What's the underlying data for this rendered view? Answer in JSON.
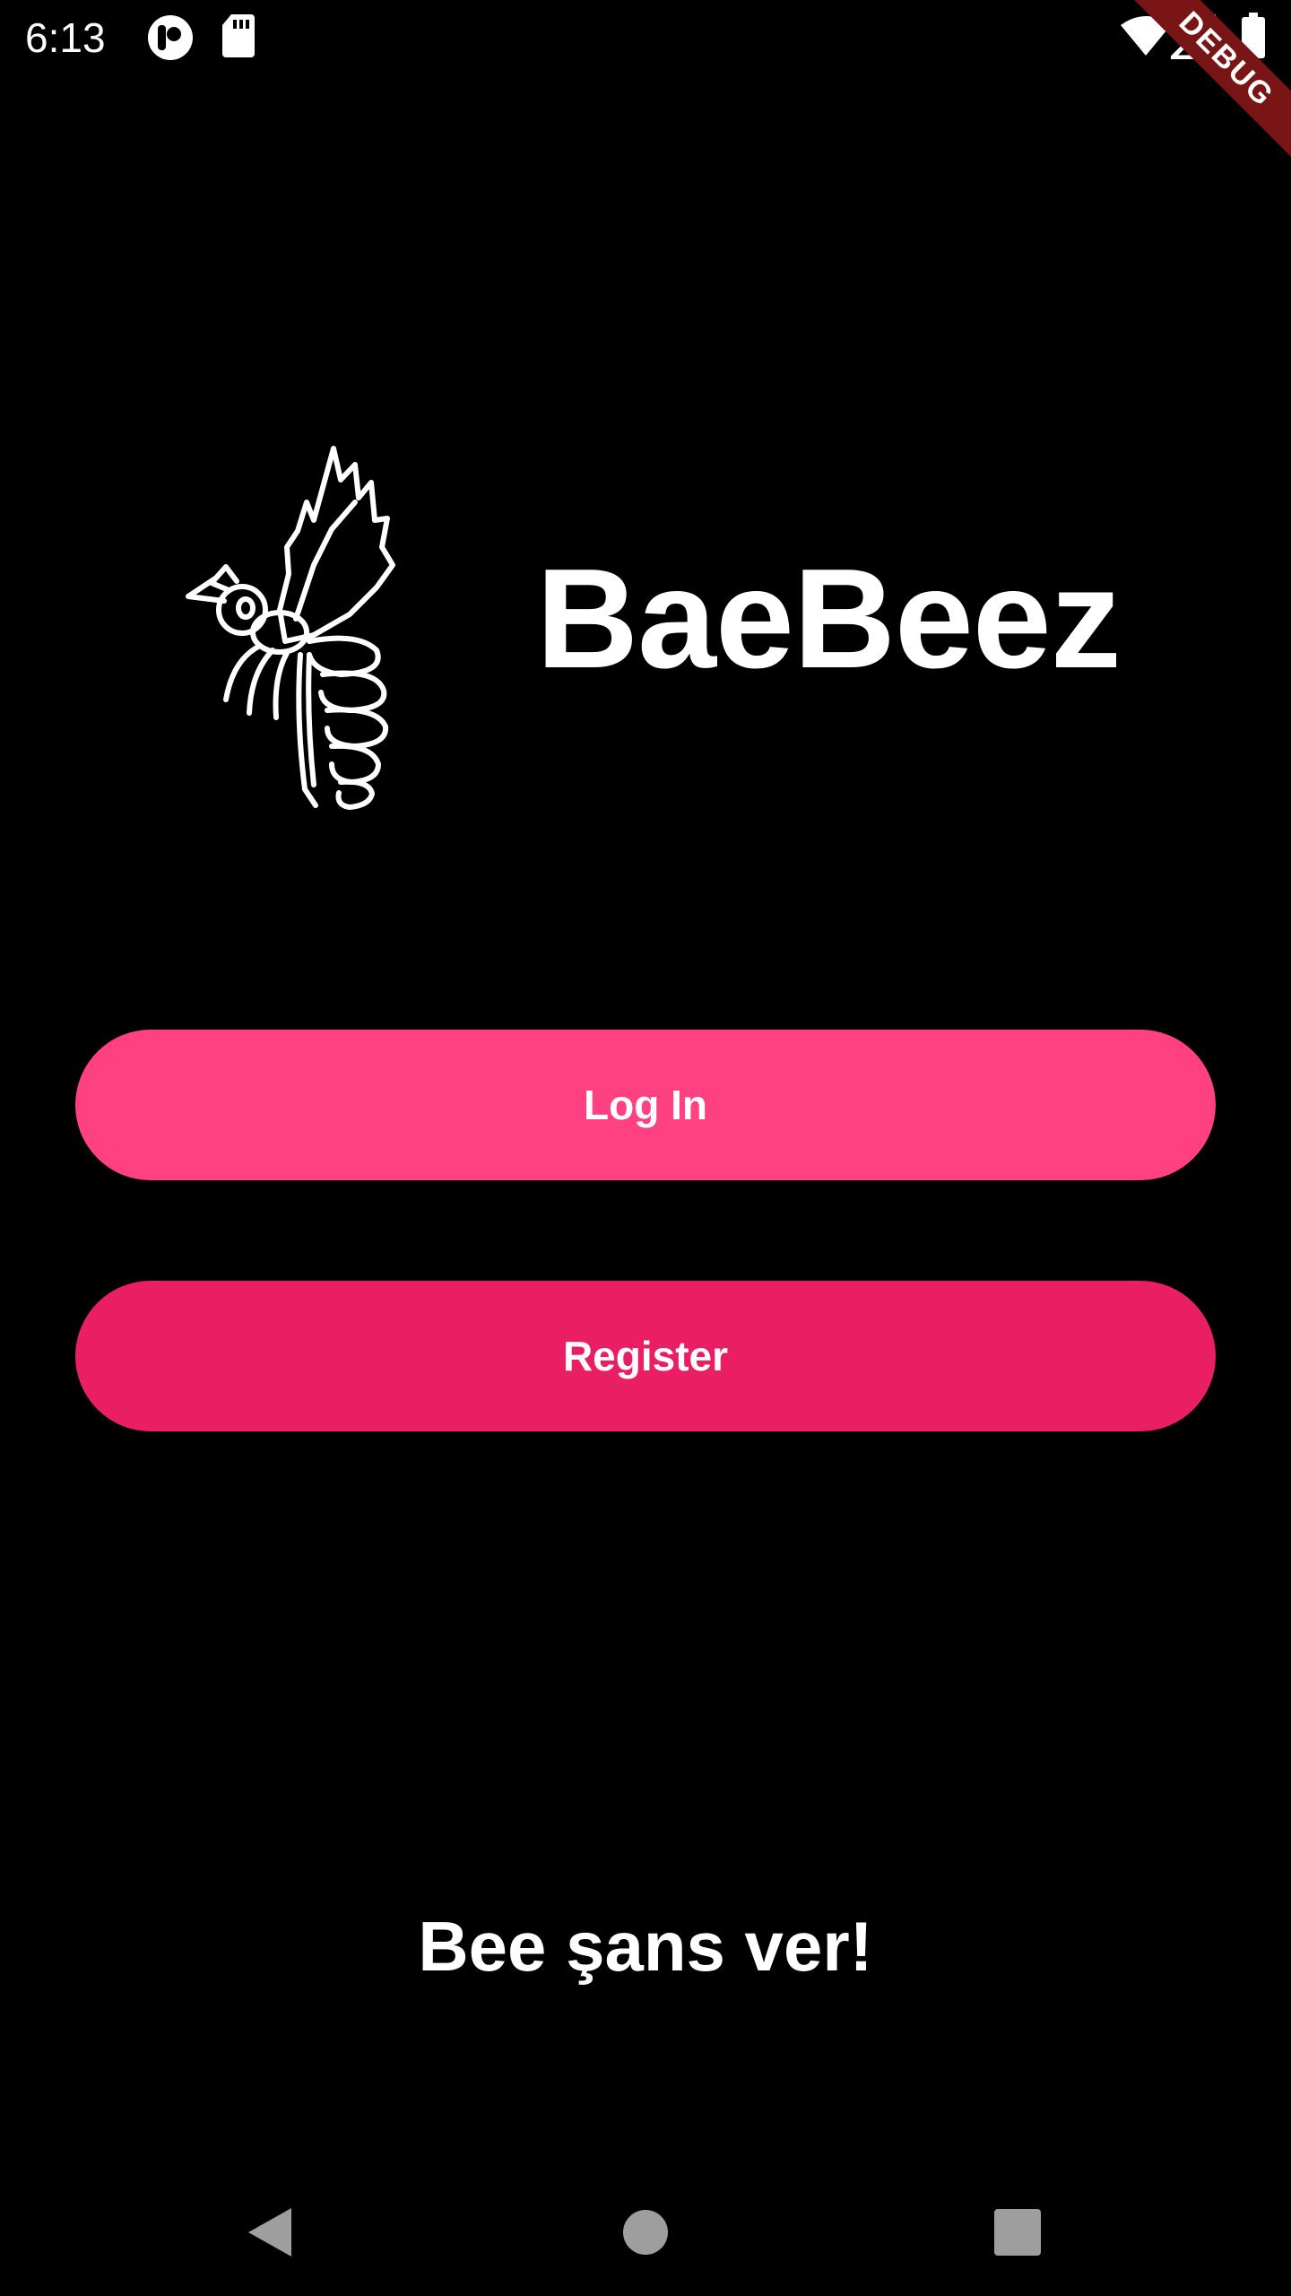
{
  "status_bar": {
    "time": "6:13",
    "icons": [
      "app-notification-icon",
      "sd-card-icon",
      "wifi-icon",
      "signal-icon",
      "battery-icon"
    ]
  },
  "debug_banner": "DEBUG",
  "logo": {
    "icon": "bee-icon",
    "app_name": "BaeBeez"
  },
  "buttons": {
    "login_label": "Log In",
    "register_label": "Register"
  },
  "slogan": "Bee şans ver!",
  "nav_bar": {
    "icons": [
      "back-icon",
      "home-icon",
      "recents-icon"
    ]
  },
  "colors": {
    "background": "#000000",
    "login_button": "#ff4081",
    "register_button": "#e91e63",
    "text": "#ffffff",
    "debug_ribbon": "#7a1515",
    "nav_icons": "#9e9e9e"
  }
}
